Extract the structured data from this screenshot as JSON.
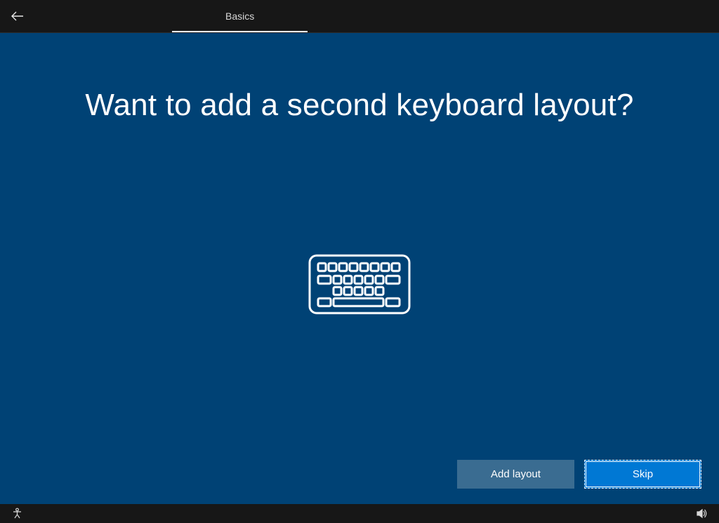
{
  "header": {
    "tab_label": "Basics"
  },
  "main": {
    "heading": "Want to add a second keyboard layout?",
    "buttons": {
      "add_layout": "Add layout",
      "skip": "Skip"
    }
  }
}
